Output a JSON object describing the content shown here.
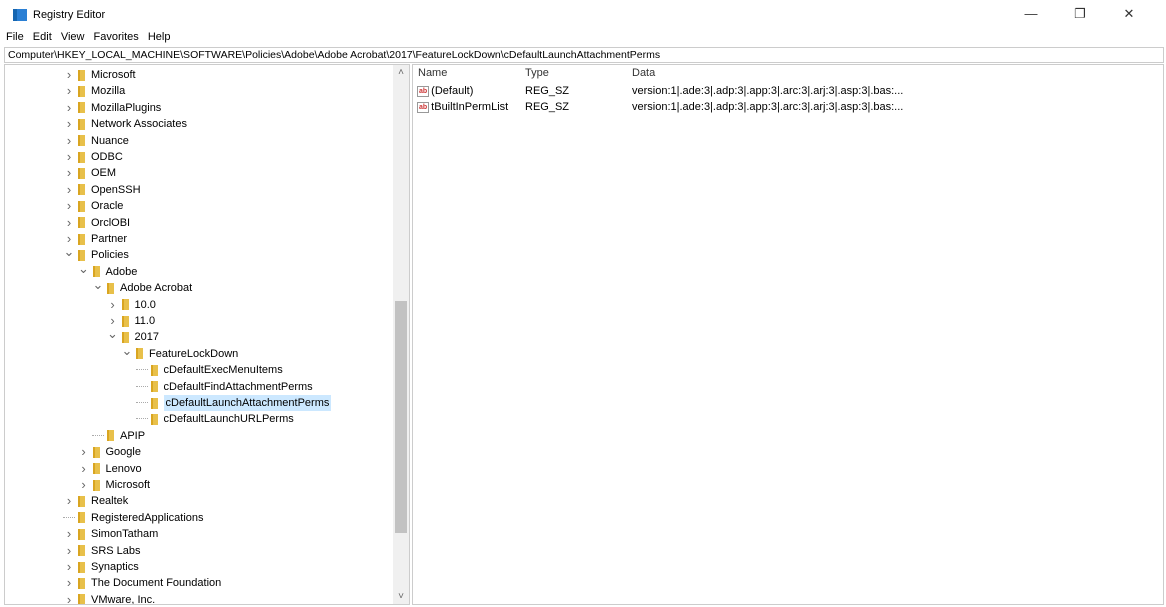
{
  "window": {
    "title": "Registry Editor",
    "minimize": "—",
    "restore": "❐",
    "close": "✕"
  },
  "menu": [
    "File",
    "Edit",
    "View",
    "Favorites",
    "Help"
  ],
  "address": "Computer\\HKEY_LOCAL_MACHINE\\SOFTWARE\\Policies\\Adobe\\Adobe Acrobat\\2017\\FeatureLockDown\\cDefaultLaunchAttachmentPerms",
  "tree": [
    {
      "label": "Microsoft",
      "level": 0,
      "state": "collapsed"
    },
    {
      "label": "Mozilla",
      "level": 0,
      "state": "collapsed"
    },
    {
      "label": "MozillaPlugins",
      "level": 0,
      "state": "collapsed"
    },
    {
      "label": "Network Associates",
      "level": 0,
      "state": "collapsed"
    },
    {
      "label": "Nuance",
      "level": 0,
      "state": "collapsed"
    },
    {
      "label": "ODBC",
      "level": 0,
      "state": "collapsed"
    },
    {
      "label": "OEM",
      "level": 0,
      "state": "collapsed"
    },
    {
      "label": "OpenSSH",
      "level": 0,
      "state": "collapsed"
    },
    {
      "label": "Oracle",
      "level": 0,
      "state": "collapsed"
    },
    {
      "label": "OrclOBI",
      "level": 0,
      "state": "collapsed"
    },
    {
      "label": "Partner",
      "level": 0,
      "state": "collapsed"
    },
    {
      "label": "Policies",
      "level": 0,
      "state": "expanded"
    },
    {
      "label": "Adobe",
      "level": 1,
      "state": "expanded"
    },
    {
      "label": "Adobe Acrobat",
      "level": 2,
      "state": "expanded"
    },
    {
      "label": "10.0",
      "level": 3,
      "state": "collapsed"
    },
    {
      "label": "11.0",
      "level": 3,
      "state": "collapsed"
    },
    {
      "label": "2017",
      "level": 3,
      "state": "expanded"
    },
    {
      "label": "FeatureLockDown",
      "level": 4,
      "state": "expanded"
    },
    {
      "label": "cDefaultExecMenuItems",
      "level": 5,
      "state": "leaf"
    },
    {
      "label": "cDefaultFindAttachmentPerms",
      "level": 5,
      "state": "leaf"
    },
    {
      "label": "cDefaultLaunchAttachmentPerms",
      "level": 5,
      "state": "leaf",
      "selected": true
    },
    {
      "label": "cDefaultLaunchURLPerms",
      "level": 5,
      "state": "leaf"
    },
    {
      "label": "APIP",
      "level": 2,
      "state": "leaf"
    },
    {
      "label": "Google",
      "level": 1,
      "state": "collapsed"
    },
    {
      "label": "Lenovo",
      "level": 1,
      "state": "collapsed"
    },
    {
      "label": "Microsoft",
      "level": 1,
      "state": "collapsed"
    },
    {
      "label": "Realtek",
      "level": 0,
      "state": "collapsed"
    },
    {
      "label": "RegisteredApplications",
      "level": 0,
      "state": "leaf"
    },
    {
      "label": "SimonTatham",
      "level": 0,
      "state": "collapsed"
    },
    {
      "label": "SRS Labs",
      "level": 0,
      "state": "collapsed"
    },
    {
      "label": "Synaptics",
      "level": 0,
      "state": "collapsed"
    },
    {
      "label": "The Document Foundation",
      "level": 0,
      "state": "collapsed"
    },
    {
      "label": "VMware, Inc.",
      "level": 0,
      "state": "collapsed"
    }
  ],
  "values": {
    "headers": {
      "name": "Name",
      "type": "Type",
      "data": "Data"
    },
    "rows": [
      {
        "icon": "ab",
        "name": "(Default)",
        "type": "REG_SZ",
        "data": "version:1|.ade:3|.adp:3|.app:3|.arc:3|.arj:3|.asp:3|.bas:..."
      },
      {
        "icon": "ab",
        "name": "tBuiltInPermList",
        "type": "REG_SZ",
        "data": "version:1|.ade:3|.adp:3|.app:3|.arc:3|.arj:3|.asp:3|.bas:..."
      }
    ]
  }
}
